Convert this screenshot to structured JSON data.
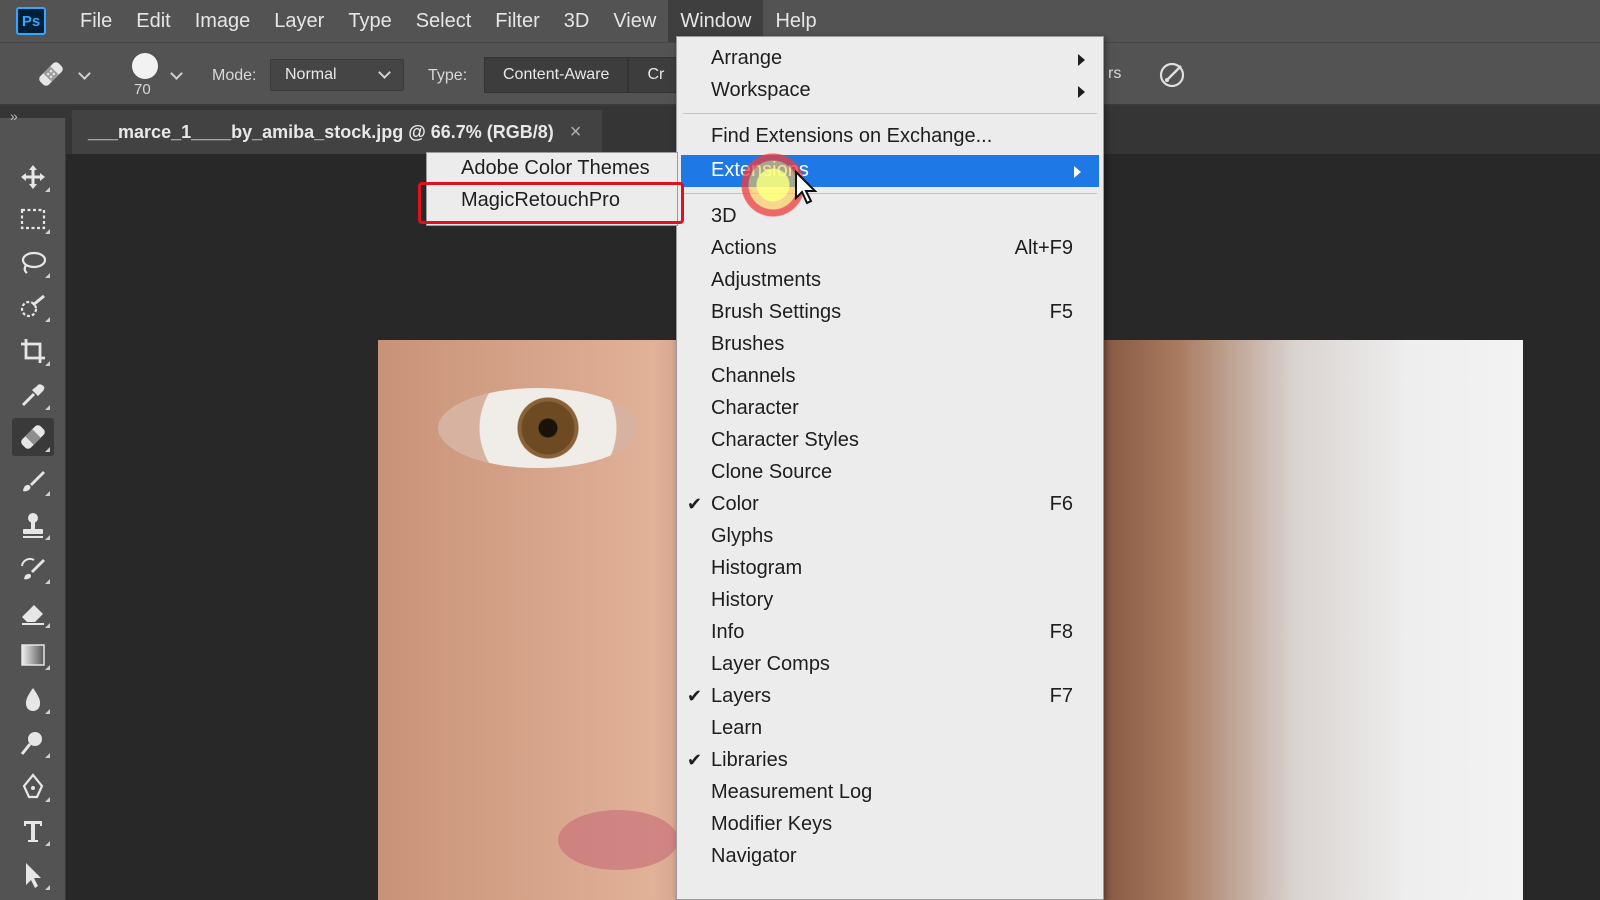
{
  "app": {
    "logo": "Ps"
  },
  "menubar": {
    "items": [
      "File",
      "Edit",
      "Image",
      "Layer",
      "Type",
      "Select",
      "Filter",
      "3D",
      "View",
      "Window",
      "Help"
    ],
    "active": "Window"
  },
  "options": {
    "tool_icon": "spot-healing-brush-icon",
    "brush_size": "70",
    "mode_label": "Mode:",
    "mode_value": "Normal",
    "type_label": "Type:",
    "type_buttons": [
      "Content-Aware",
      "Cr"
    ],
    "partial_right_text": "rs",
    "angle_icon": "brush-angle-icon"
  },
  "document": {
    "tab_title": "___marce_1____by_amiba_stock.jpg @ 66.7% (RGB/8)",
    "close_glyph": "×"
  },
  "toolbar": {
    "collapse": "»",
    "tools": [
      "move-icon",
      "marquee-icon",
      "lasso-icon",
      "quick-selection-icon",
      "crop-icon",
      "eyedropper-icon",
      "spot-healing-icon",
      "brush-icon",
      "clone-stamp-icon",
      "history-brush-icon",
      "eraser-icon",
      "gradient-icon",
      "blur-icon",
      "dodge-icon",
      "pen-icon",
      "type-icon",
      "path-selection-icon"
    ],
    "selected": "spot-healing-icon"
  },
  "window_menu": {
    "arrange": "Arrange",
    "workspace": "Workspace",
    "find_extensions": "Find Extensions on Exchange...",
    "extensions": "Extensions",
    "items": [
      {
        "label": "3D",
        "shortcut": "",
        "checked": false
      },
      {
        "label": "Actions",
        "shortcut": "Alt+F9",
        "checked": false
      },
      {
        "label": "Adjustments",
        "shortcut": "",
        "checked": false
      },
      {
        "label": "Brush Settings",
        "shortcut": "F5",
        "checked": false
      },
      {
        "label": "Brushes",
        "shortcut": "",
        "checked": false
      },
      {
        "label": "Channels",
        "shortcut": "",
        "checked": false
      },
      {
        "label": "Character",
        "shortcut": "",
        "checked": false
      },
      {
        "label": "Character Styles",
        "shortcut": "",
        "checked": false
      },
      {
        "label": "Clone Source",
        "shortcut": "",
        "checked": false
      },
      {
        "label": "Color",
        "shortcut": "F6",
        "checked": true
      },
      {
        "label": "Glyphs",
        "shortcut": "",
        "checked": false
      },
      {
        "label": "Histogram",
        "shortcut": "",
        "checked": false
      },
      {
        "label": "History",
        "shortcut": "",
        "checked": false
      },
      {
        "label": "Info",
        "shortcut": "F8",
        "checked": false
      },
      {
        "label": "Layer Comps",
        "shortcut": "",
        "checked": false
      },
      {
        "label": "Layers",
        "shortcut": "F7",
        "checked": true
      },
      {
        "label": "Learn",
        "shortcut": "",
        "checked": false
      },
      {
        "label": "Libraries",
        "shortcut": "",
        "checked": true
      },
      {
        "label": "Measurement Log",
        "shortcut": "",
        "checked": false
      },
      {
        "label": "Modifier Keys",
        "shortcut": "",
        "checked": false
      },
      {
        "label": "Navigator",
        "shortcut": "",
        "checked": false
      }
    ],
    "check_glyph": "✔"
  },
  "extensions_submenu": {
    "items": [
      "Adobe Color Themes",
      "MagicRetouchPro"
    ],
    "highlighted": "MagicRetouchPro"
  },
  "colors": {
    "menu_highlight": "#1e78e6",
    "annotation_red": "#e0101e",
    "chrome": "#535353",
    "canvas_bg": "#282828"
  }
}
